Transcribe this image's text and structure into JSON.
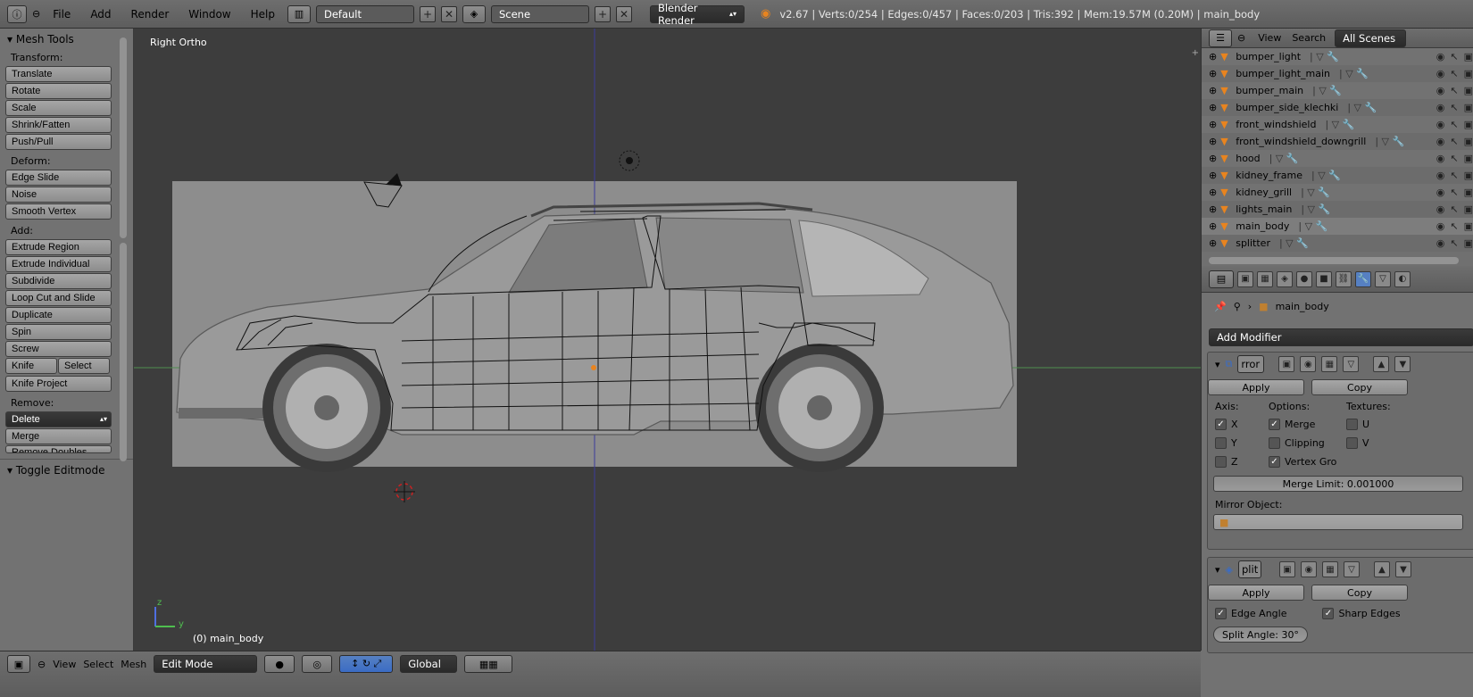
{
  "topbar": {
    "menus": [
      "File",
      "Add",
      "Render",
      "Window",
      "Help"
    ],
    "layout": "Default",
    "scene": "Scene",
    "engine": "Blender Render",
    "status": "v2.67 | Verts:0/254 | Edges:0/457 | Faces:0/203 | Tris:392 | Mem:19.57M (0.20M) | main_body"
  },
  "tools": {
    "header": "Mesh Tools",
    "transform_label": "Transform:",
    "transform": [
      "Translate",
      "Rotate",
      "Scale",
      "Shrink/Fatten",
      "Push/Pull"
    ],
    "deform_label": "Deform:",
    "deform": [
      "Edge Slide",
      "Noise",
      "Smooth Vertex"
    ],
    "add_label": "Add:",
    "add": [
      "Extrude Region",
      "Extrude Individual",
      "Subdivide",
      "Loop Cut and Slide",
      "Duplicate",
      "Spin",
      "Screw"
    ],
    "knife": "Knife",
    "select": "Select",
    "knife_project": "Knife Project",
    "remove_label": "Remove:",
    "delete": "Delete",
    "merge": "Merge",
    "remove_doubles": "Remove Doubles",
    "toggle_editmode": "Toggle Editmode"
  },
  "viewport": {
    "view_name": "Right Ortho",
    "object_label": "(0) main_body",
    "axis_z": "z",
    "axis_y": "y"
  },
  "outliner": {
    "view": "View",
    "search": "Search",
    "scope": "All Scenes",
    "items": [
      "bumper_light",
      "bumper_light_main",
      "bumper_main",
      "bumper_side_klechki",
      "front_windshield",
      "front_windshield_downgrill",
      "hood",
      "kidney_frame",
      "kidney_grill",
      "lights_main",
      "main_body",
      "splitter"
    ],
    "active_item": "main_body"
  },
  "properties": {
    "object_name": "main_body",
    "add_modifier": "Add Modifier",
    "mirror": {
      "name": "rror",
      "apply": "Apply",
      "copy": "Copy",
      "axis_label": "Axis:",
      "options_label": "Options:",
      "textures_label": "Textures:",
      "x": "X",
      "y": "Y",
      "z": "Z",
      "merge": "Merge",
      "clipping": "Clipping",
      "vertex_groups": "Vertex Gro",
      "u": "U",
      "v": "V",
      "merge_limit": "Merge Limit: 0.001000",
      "mirror_object": "Mirror Object:"
    },
    "edge_split": {
      "name": "plit",
      "apply": "Apply",
      "copy": "Copy",
      "edge_angle": "Edge Angle",
      "sharp_edges": "Sharp Edges",
      "split_angle": "Split Angle: 30°"
    }
  },
  "bottombar": {
    "menus": [
      "View",
      "Select",
      "Mesh"
    ],
    "mode": "Edit Mode",
    "orientation": "Global"
  }
}
